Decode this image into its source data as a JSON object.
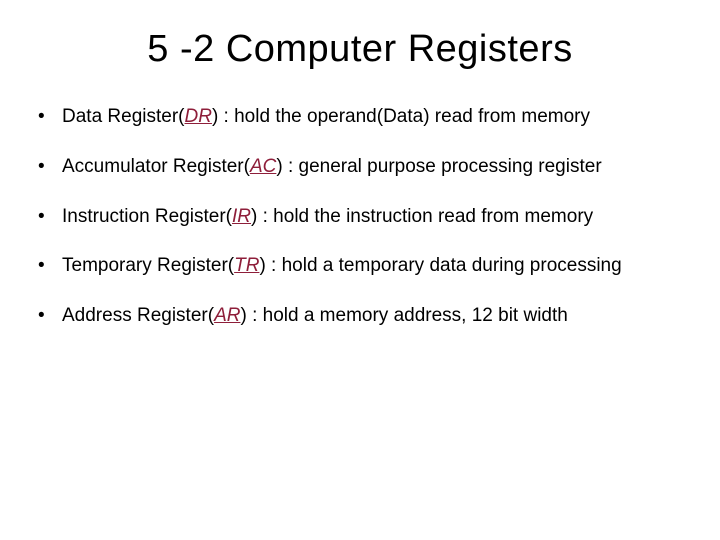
{
  "title": "5 -2  Computer Registers",
  "bullets": [
    {
      "pre": "Data Register(",
      "abbr": "DR",
      "post": ") : hold the operand(Data) read from memory"
    },
    {
      "pre": "Accumulator Register(",
      "abbr": "AC",
      "post": ") : general purpose processing register"
    },
    {
      "pre": "Instruction Register(",
      "abbr": "IR",
      "post": ") : hold the instruction read from memory"
    },
    {
      "pre": "Temporary Register(",
      "abbr": "TR",
      "post": ") : hold a temporary data during processing"
    },
    {
      "pre": "Address Register(",
      "abbr": "AR",
      "post": ") : hold a memory address, 12 bit width"
    }
  ],
  "bullet_char": "•"
}
